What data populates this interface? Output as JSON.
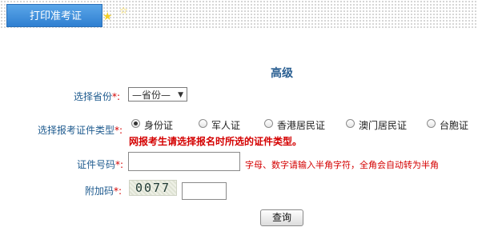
{
  "tab": {
    "label": "打印准考证"
  },
  "form": {
    "title": "高级",
    "province": {
      "label": "选择省份",
      "required_mark": "*:",
      "selected": "—省份—"
    },
    "id_type": {
      "label": "选择报考证件类型",
      "required_mark": "*:",
      "options": [
        "身份证",
        "军人证",
        "香港居民证",
        "澳门居民证",
        "台胞证"
      ],
      "selected_index": 0,
      "warning": "网报考生请选择报名时所选的证件类型。"
    },
    "id_number": {
      "label": "证件号码",
      "required_mark": "*:",
      "value": "",
      "hint": "字母、数字请输入半角字符，全角会自动转为半角"
    },
    "captcha": {
      "label": "附加码",
      "required_mark": "*:",
      "image_text": "0077",
      "value": ""
    },
    "submit_label": "查询"
  },
  "colors": {
    "accent": "#2f7fd1",
    "label": "#1f5b8f",
    "required": "#d40000"
  }
}
